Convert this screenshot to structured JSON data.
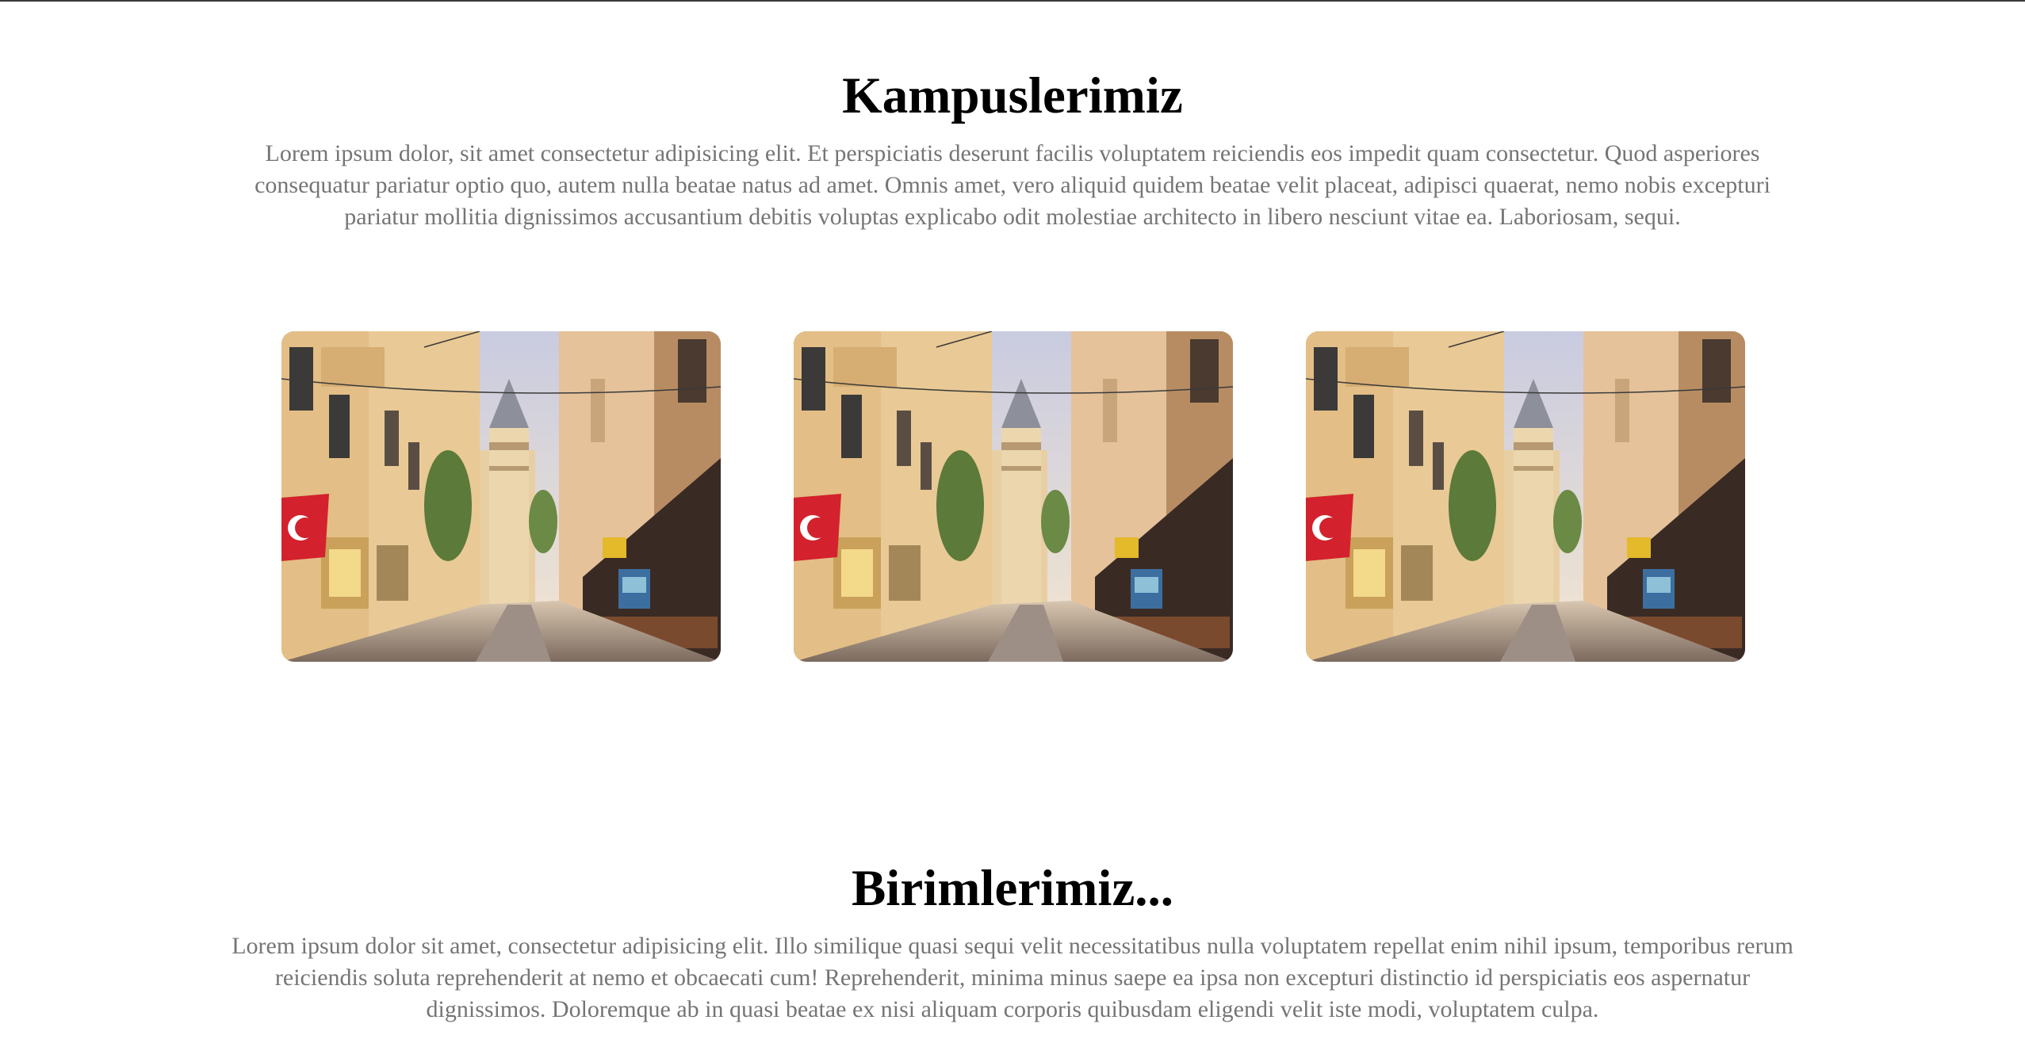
{
  "campuses": {
    "title": "Kampuslerimiz",
    "description": "Lorem ipsum dolor, sit amet consectetur adipisicing elit. Et perspiciatis deserunt facilis voluptatem reiciendis eos impedit quam consectetur. Quod asperiores consequatur pariatur optio quo, autem nulla beatae natus ad amet. Omnis amet, vero aliquid quidem beatae velit placeat, adipisci quaerat, nemo nobis excepturi pariatur mollitia dignissimos accusantium debitis voluptas explicabo odit molestiae architecto in libero nesciunt vitae ea. Laboriosam, sequi.",
    "images": [
      {
        "subject": "istanbul-galata-street-photo"
      },
      {
        "subject": "istanbul-galata-street-photo"
      },
      {
        "subject": "istanbul-galata-street-photo"
      }
    ]
  },
  "units": {
    "title": "Birimlerimiz...",
    "description": "Lorem ipsum dolor sit amet, consectetur adipisicing elit. Illo similique quasi sequi velit necessitatibus nulla voluptatem repellat enim nihil ipsum, temporibus rerum reiciendis soluta reprehenderit at nemo et obcaecati cum! Reprehenderit, minima minus saepe ea ipsa non excepturi distinctio id perspiciatis eos aspernatur dignissimos. Doloremque ab in quasi beatae ex nisi aliquam corporis quibusdam eligendi velit iste modi, voluptatem culpa."
  },
  "colors": {
    "heading": "#000000",
    "body_text": "#757575",
    "background": "#ffffff"
  }
}
